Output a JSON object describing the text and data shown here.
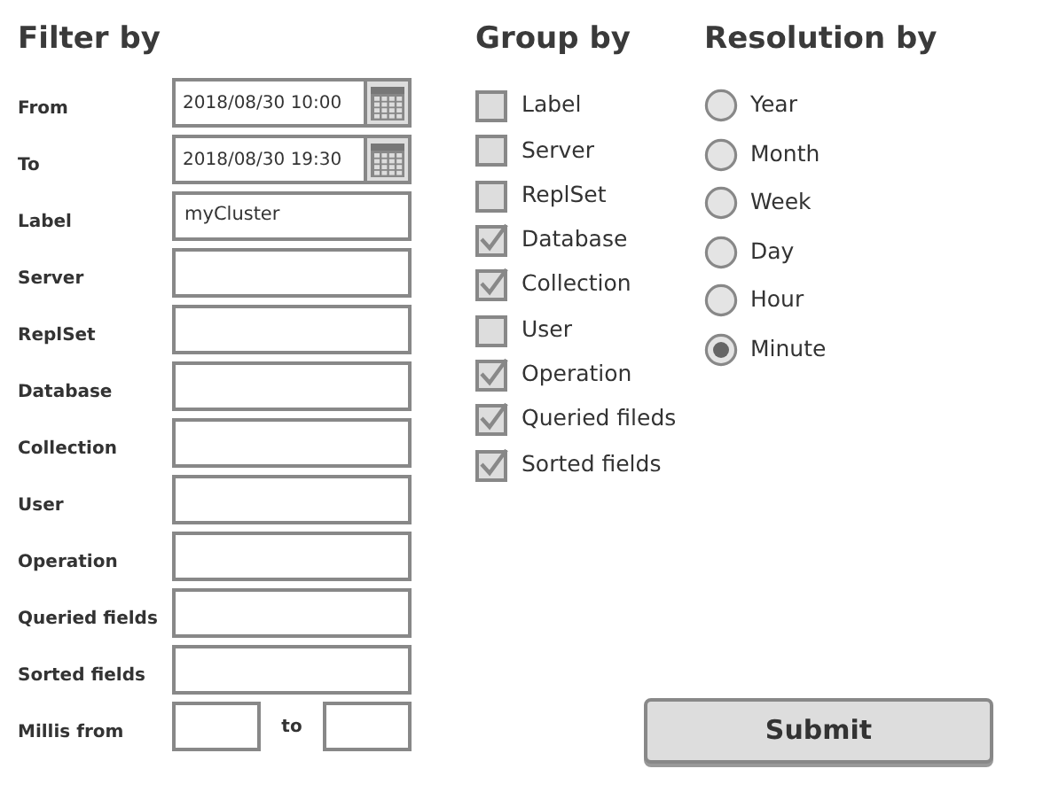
{
  "filter": {
    "title": "Filter by",
    "rows": [
      {
        "label": "From",
        "kind": "datetime",
        "value": "2018/08/30 10:00"
      },
      {
        "label": "To",
        "kind": "datetime",
        "value": "2018/08/30 19:30"
      },
      {
        "label": "Label",
        "kind": "text",
        "value": "myCluster"
      },
      {
        "label": "Server",
        "kind": "text"
      },
      {
        "label": "ReplSet",
        "kind": "text"
      },
      {
        "label": "Database",
        "kind": "text"
      },
      {
        "label": "Collection",
        "kind": "text"
      },
      {
        "label": "User",
        "kind": "text"
      },
      {
        "label": "Operation",
        "kind": "text"
      },
      {
        "label": "Queried fields",
        "kind": "text"
      },
      {
        "label": "Sorted fields",
        "kind": "text"
      },
      {
        "label": "Millis from",
        "kind": "range",
        "separator": "to"
      }
    ]
  },
  "group": {
    "title": "Group by",
    "options": [
      {
        "label": "Label",
        "checked": false
      },
      {
        "label": "Server",
        "checked": false
      },
      {
        "label": "ReplSet",
        "checked": false
      },
      {
        "label": "Database",
        "checked": true
      },
      {
        "label": "Collection",
        "checked": true
      },
      {
        "label": "User",
        "checked": false
      },
      {
        "label": "Operation",
        "checked": true
      },
      {
        "label": "Queried fileds",
        "checked": true
      },
      {
        "label": "Sorted fields",
        "checked": true
      }
    ]
  },
  "resolution": {
    "title": "Resolution by",
    "options": [
      {
        "label": "Year",
        "selected": false
      },
      {
        "label": "Month",
        "selected": false
      },
      {
        "label": "Week",
        "selected": false
      },
      {
        "label": "Day",
        "selected": false
      },
      {
        "label": "Hour",
        "selected": false
      },
      {
        "label": "Minute",
        "selected": true
      }
    ]
  },
  "submit": "Submit"
}
